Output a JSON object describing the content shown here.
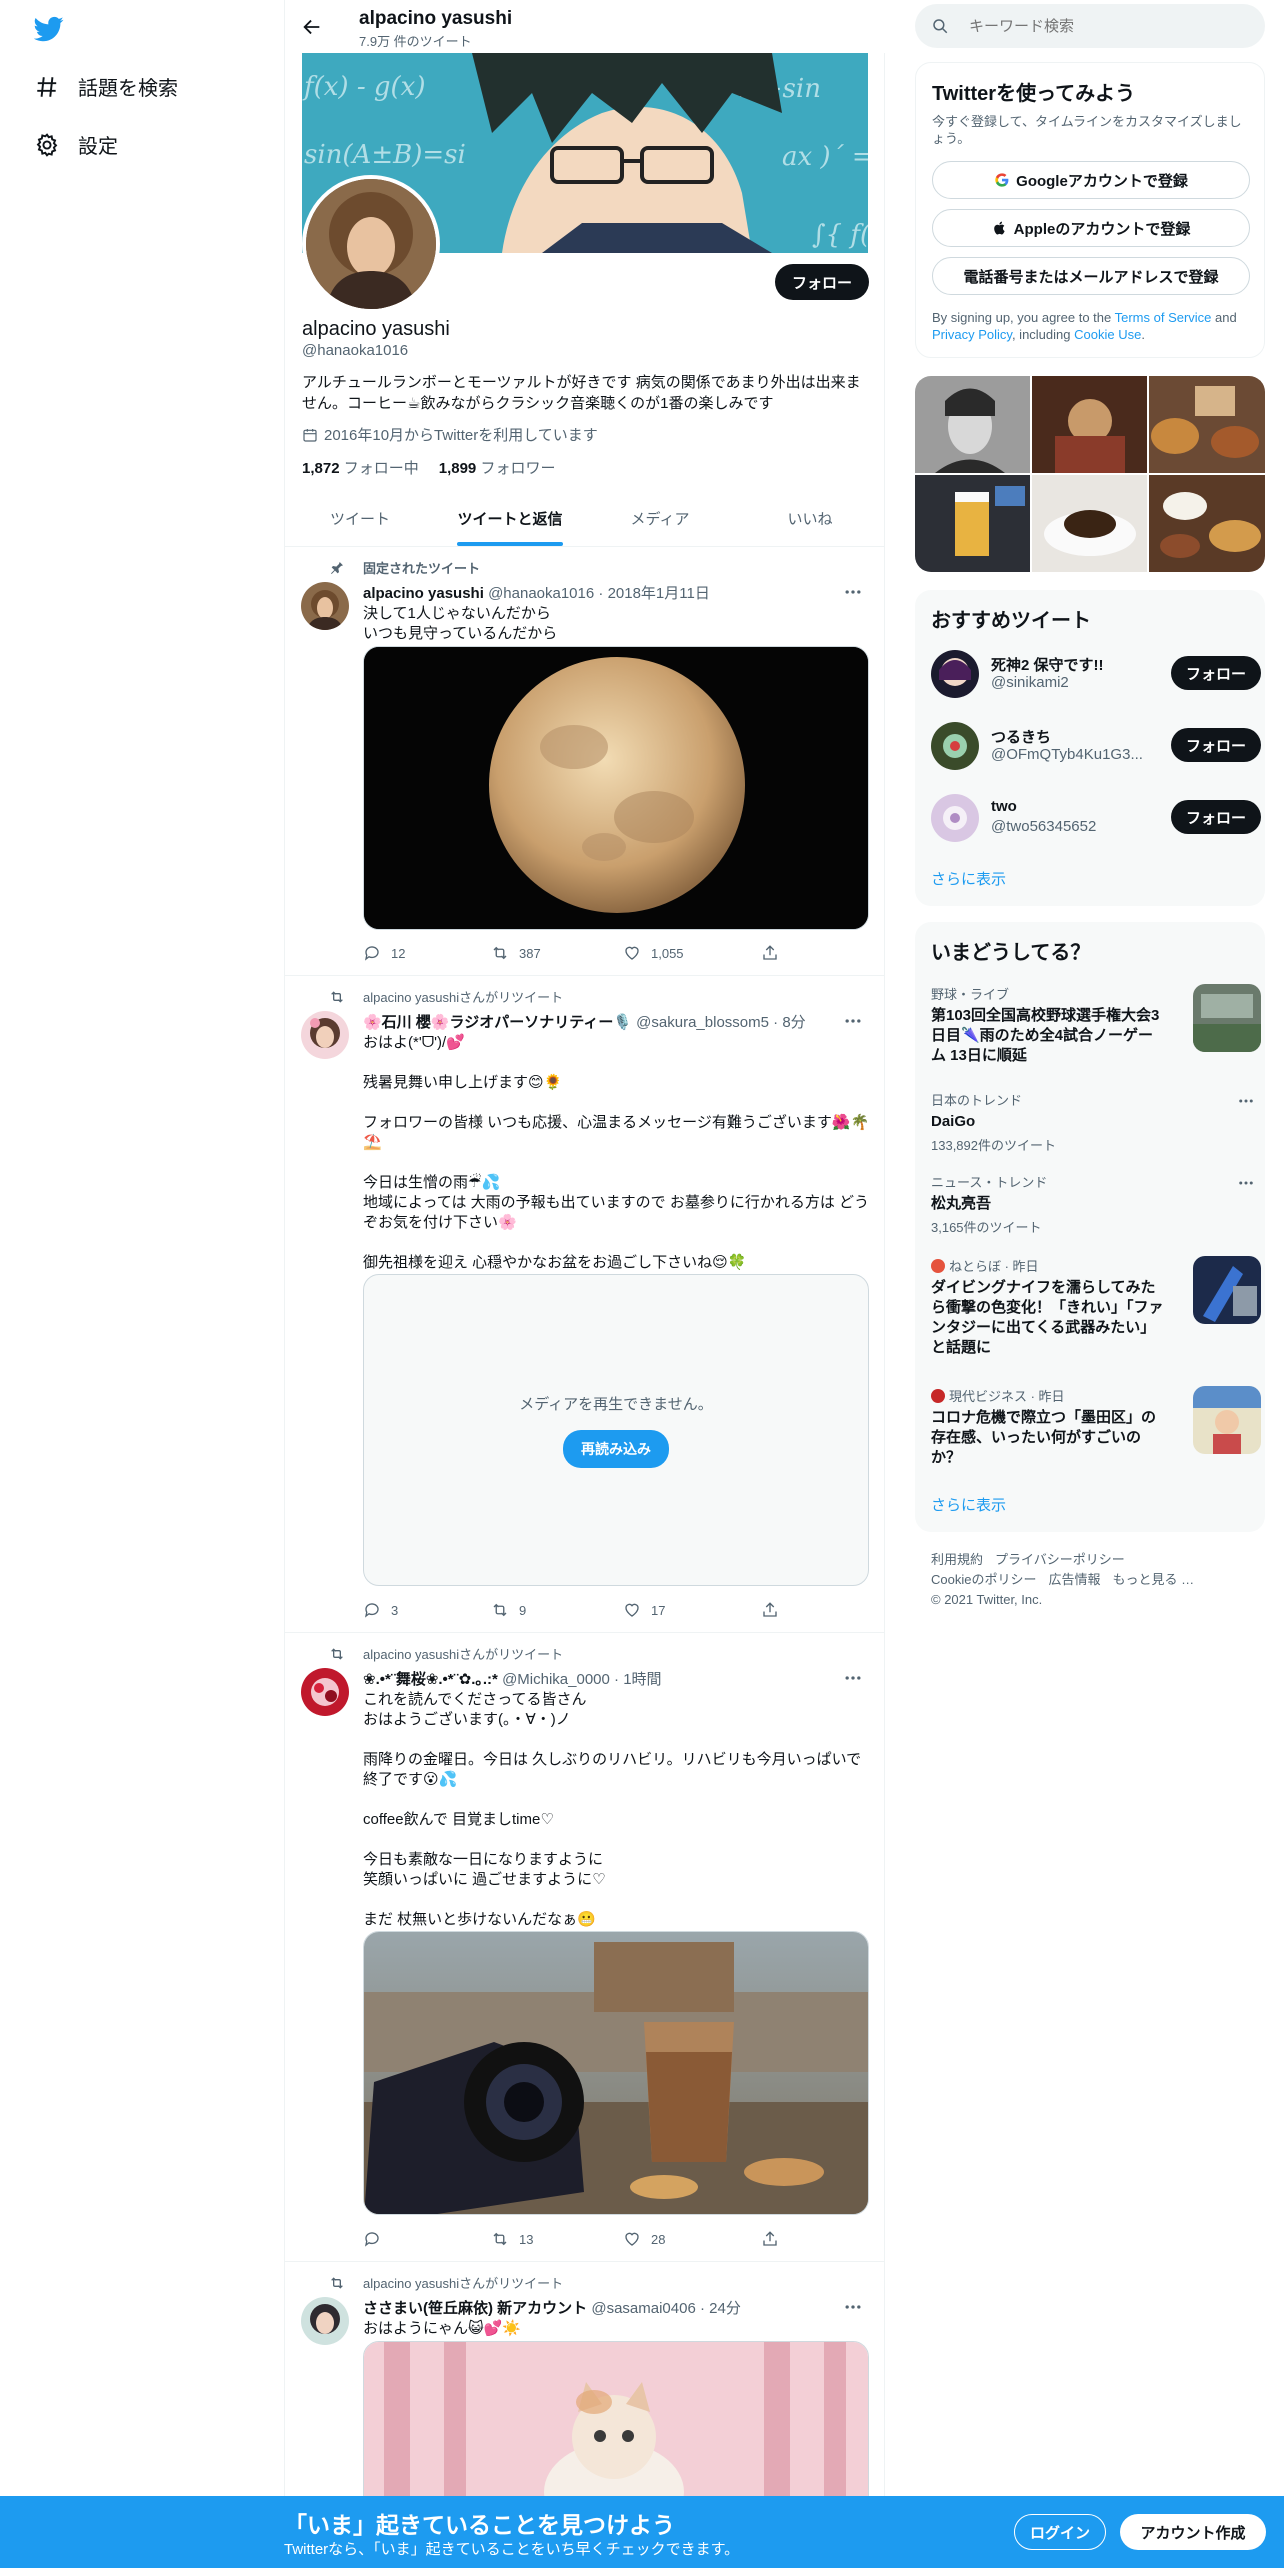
{
  "nav": {
    "explore_label": "話題を検索",
    "settings_label": "設定"
  },
  "header": {
    "name": "alpacino yasushi",
    "tweet_count": "7.9万 件のツイート"
  },
  "profile": {
    "follow_label": "フォロー",
    "name": "alpacino yasushi",
    "handle": "@hanaoka1016",
    "bio": "アルチュールランボーとモーツァルトが好きです 病気の関係であまり外出は出来ません。コーヒー☕飲みながらクラシック音楽聴くのが1番の楽しみです",
    "joined": "2016年10月からTwitterを利用しています",
    "following_count": "1,872",
    "following_label": "フォロー中",
    "followers_count": "1,899",
    "followers_label": "フォロワー"
  },
  "tabs": [
    {
      "label": "ツイート"
    },
    {
      "label": "ツイートと返信"
    },
    {
      "label": "メディア"
    },
    {
      "label": "いいね"
    }
  ],
  "tweets": [
    {
      "context": "固定されたツイート",
      "name": "alpacino yasushi",
      "handle": "@hanaoka1016",
      "time": "2018年1月11日",
      "text": "決して1人じゃないんだから\nいつも見守っているんだから",
      "replies": "12",
      "retweets": "387",
      "likes": "1,055"
    },
    {
      "context": "alpacino yasushiさんがリツイート",
      "name": "🌸石川 櫻🌸ラジオパーソナリティー🎙️",
      "handle": "@sakura_blossom5",
      "time": "8分",
      "text": "おはよ(*'ᗜ')/💕\n\n残暑見舞い申し上げます😊🌻\n\nフォロワーの皆様 いつも応援、心温まるメッセージ有難うございます🌺🌴⛱️\n\n今日は生憎の雨☔💦\n地域によっては 大雨の予報も出ていますので お墓参りに行かれる方は どうぞお気を付け下さい🌸\n\n御先祖様を迎え 心穏やかなお盆をお過ごし下さいね😌🍀",
      "media_error": "メディアを再生できません。",
      "reload_label": "再読み込み",
      "replies": "3",
      "retweets": "9",
      "likes": "17"
    },
    {
      "context": "alpacino yasushiさんがリツイート",
      "name": "❀.•*¨舞桜❀.•*¨✿.｡.:*",
      "handle": "@Michika_0000",
      "time": "1時間",
      "text": "これを読んでくださってる皆さん\nおはようございます(。・∀・)ノ\n\n雨降りの金曜日。今日は 久しぶりのリハビリ。リハビリも今月いっぱいで終了です😮💦\n\ncoffee飲んで 目覚ましtime♡\n\n今日も素敵な一日になりますように\n笑顔いっぱいに 過ごせますように♡\n\nまだ 杖無いと歩けないんだなぁ😬",
      "replies": "",
      "retweets": "13",
      "likes": "28"
    },
    {
      "context": "alpacino yasushiさんがリツイート",
      "name": "ささまい(笹丘麻依) 新アカウント",
      "handle": "@sasamai0406",
      "time": "24分",
      "text": "おはようにゃん😺💕☀️"
    }
  ],
  "search": {
    "placeholder": "キーワード検索"
  },
  "signup": {
    "title": "Twitterを使ってみよう",
    "subtitle": "今すぐ登録して、タイムラインをカスタマイズしましょう。",
    "google_label": "Googleアカウントで登録",
    "apple_label": "Appleのアカウントで登録",
    "phone_label": "電話番号またはメールアドレスで登録",
    "legal_prefix": "By signing up, you agree to the ",
    "tos": "Terms of Service",
    "and": " and ",
    "privacy": "Privacy Policy",
    "including": ", including ",
    "cookie": "Cookie Use",
    "period": "."
  },
  "who_to_follow": {
    "title": "おすすめツイート",
    "follow_label": "フォロー",
    "show_more": "さらに表示",
    "users": [
      {
        "name": "死神2 保守です!!",
        "handle": "@sinikami2"
      },
      {
        "name": "つるきち",
        "handle": "@OFmQTyb4Ku1G3..."
      },
      {
        "name": "two",
        "handle": "@two56345652"
      }
    ]
  },
  "trends": {
    "title": "いまどうしてる？",
    "show_more": "さらに表示",
    "items": [
      {
        "meta": "野球・ライブ",
        "title": "第103回全国高校野球選手権大会3日目🌂雨のため全4試合ノーゲーム 13日に順延",
        "count": ""
      },
      {
        "meta": "日本のトレンド",
        "title": "DaiGo",
        "count": "133,892件のツイート"
      },
      {
        "meta": "ニュース・トレンド",
        "title": "松丸亮吾",
        "count": "3,165件のツイート"
      },
      {
        "meta": "ねとらぼ · 昨日",
        "title": "ダイビングナイフを濡らしてみたら衝撃の色変化！「きれい」「ファンタジーに出てくる武器みたい」と話題に",
        "count": ""
      },
      {
        "meta": "現代ビジネス · 昨日",
        "title": "コロナ危機で際立つ「墨田区」の存在感、いったい何がすごいのか？",
        "count": ""
      }
    ]
  },
  "footer": {
    "links": [
      "利用規約",
      "プライバシーポリシー",
      "Cookieのポリシー",
      "広告情報",
      "もっと見る …"
    ],
    "copyright": "© 2021 Twitter, Inc."
  },
  "bottom_bar": {
    "title": "「いま」起きていることを見つけよう",
    "subtitle": "Twitterなら、「いま」起きていることをいち早くチェックできます。",
    "login_label": "ログイン",
    "signup_label": "アカウント作成"
  },
  "colors": {
    "accent": "#1d9bf0",
    "text": "#0f1419",
    "muted": "#536471"
  }
}
